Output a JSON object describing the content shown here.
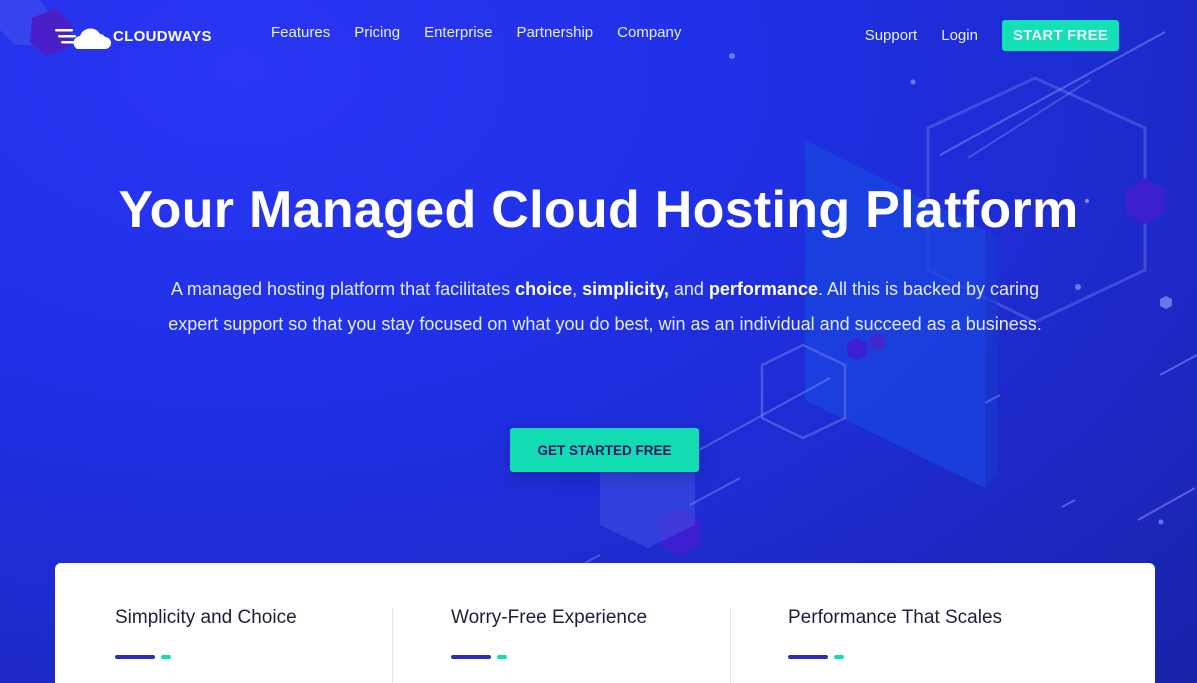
{
  "brand": {
    "name": "CLOUDWAYS"
  },
  "nav": {
    "links": [
      "Features",
      "Pricing",
      "Enterprise",
      "Partnership",
      "Company"
    ],
    "support": "Support",
    "login": "Login",
    "start_free": "START FREE"
  },
  "hero": {
    "title": "Your Managed Cloud Hosting Platform",
    "subtitle": {
      "part1": "A managed hosting platform that facilitates ",
      "bold1": "choice",
      "sep1": ", ",
      "bold2": "simplicity,",
      "part2": " and ",
      "bold3": "performance",
      "part3": ". All this is backed by caring expert support so that you stay focused on what you do best, win as an individual and succeed as a business."
    },
    "cta": "GET STARTED FREE"
  },
  "features": [
    {
      "title": "Simplicity and Choice"
    },
    {
      "title": "Worry-Free Experience"
    },
    {
      "title": "Performance That Scales"
    }
  ],
  "colors": {
    "accent": "#13dcb3",
    "background": "#1f2ae0",
    "underline": "#2a2fbf"
  }
}
